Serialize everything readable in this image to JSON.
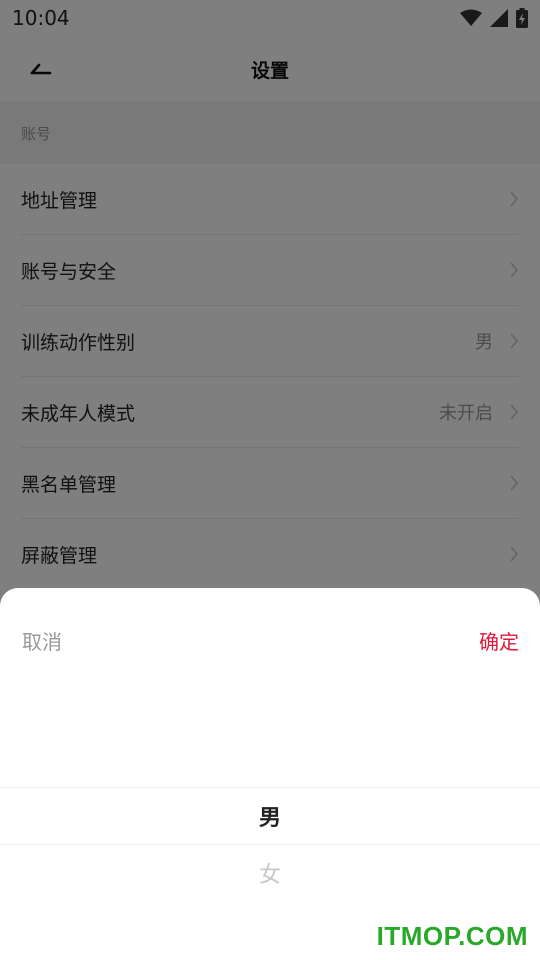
{
  "status_bar": {
    "time": "10:04",
    "icons": [
      "wifi-icon",
      "cell-signal-icon",
      "battery-icon"
    ]
  },
  "app_bar": {
    "title": "设置",
    "back_icon": "back-arrow-icon"
  },
  "section": {
    "header": "账号"
  },
  "settings_items": [
    {
      "label": "地址管理",
      "value": ""
    },
    {
      "label": "账号与安全",
      "value": ""
    },
    {
      "label": "训练动作性别",
      "value": "男"
    },
    {
      "label": "未成年人模式",
      "value": "未开启"
    },
    {
      "label": "黑名单管理",
      "value": ""
    },
    {
      "label": "屏蔽管理",
      "value": ""
    }
  ],
  "bottom_sheet": {
    "cancel_label": "取消",
    "confirm_label": "确定",
    "options": [
      "男",
      "女"
    ],
    "selected": "男"
  },
  "watermark": "ITMOP.COM",
  "colors": {
    "accent": "#e0193d",
    "watermark": "#2aa82a"
  }
}
